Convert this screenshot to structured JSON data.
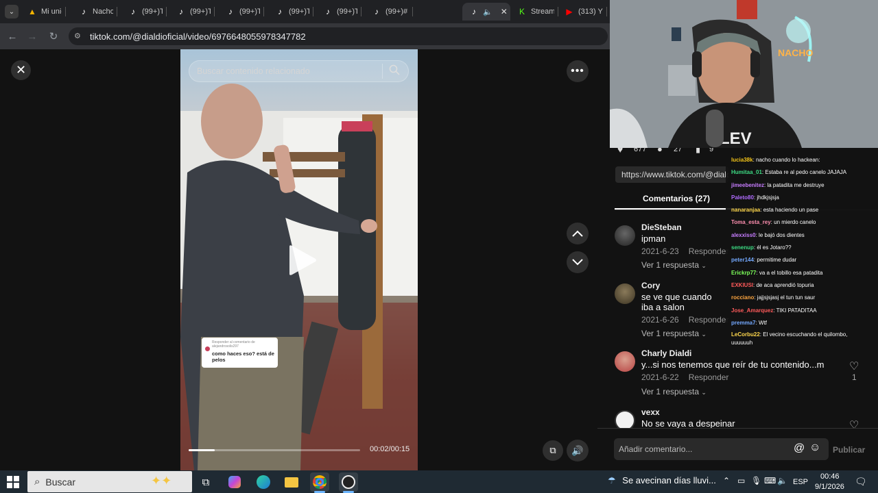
{
  "browser": {
    "tabs": [
      {
        "label": "Mi unio",
        "icon": "google-drive-icon"
      },
      {
        "label": "Nacho",
        "icon": "tiktok-icon"
      },
      {
        "label": "(99+)Ti",
        "icon": "tiktok-icon"
      },
      {
        "label": "(99+)Ti",
        "icon": "tiktok-icon"
      },
      {
        "label": "(99+)Ti",
        "icon": "tiktok-icon"
      },
      {
        "label": "(99+)Ti",
        "icon": "tiktok-icon"
      },
      {
        "label": "(99+)Ti",
        "icon": "tiktok-icon"
      },
      {
        "label": "(99+)#",
        "icon": "tiktok-icon"
      },
      {
        "label": "Stream",
        "icon": "kick-icon"
      },
      {
        "label": "(313) Y",
        "icon": "youtube-icon"
      }
    ],
    "url": "tiktok.com/@dialdioficial/video/6976648055978347782"
  },
  "video": {
    "search_placeholder": "Buscar contenido relacionado",
    "reply_card_title": "Responder al comentario de",
    "reply_card_user": "alejandrosolis297",
    "reply_card_text": "como haces eso? está de pelos",
    "time": "00:02/00:15",
    "progress": 0.15
  },
  "sidebar": {
    "stats": {
      "likes": "677",
      "comments": "27",
      "saves": "9"
    },
    "share_url": "https://www.tiktok.com/@dialdi",
    "comments_tab": "Comentarios (27)",
    "comments": [
      {
        "name": "DieSteban",
        "text": "ipman",
        "date": "2021-6-23",
        "reply": "Responder",
        "more": "Ver 1 respuesta"
      },
      {
        "name": "Cory",
        "text": "se ve que cuando iba a salon",
        "date": "2021-6-26",
        "reply": "Responder",
        "more": "Ver 1 respuesta"
      },
      {
        "name": "Charly Dialdi",
        "text": "y...si nos tenemos que reír de tu contenido...m",
        "date": "2021-6-22",
        "reply": "Responder",
        "more": "Ver 1 respuesta",
        "likes": "1"
      },
      {
        "name": "vexx",
        "text": "No se vaya a despeinar",
        "date": "",
        "reply": "",
        "more": ""
      }
    ],
    "comment_placeholder": "Añadir comentario...",
    "publish": "Publicar"
  },
  "stream_chat": [
    {
      "user": "lucia38k",
      "msg": "nacho cuando lo hackean:",
      "color": "#f5c518"
    },
    {
      "user": "Humitaa_01",
      "msg": "Estaba re al pedo canelo JAJAJA",
      "color": "#3ddc84"
    },
    {
      "user": "jimeebenitez",
      "msg": "la patadita me destruye",
      "color": "#c77dff"
    },
    {
      "user": "Paleto80",
      "msg": "jhdkjsjsja",
      "color": "#b06cff"
    },
    {
      "user": "nanaranjaa",
      "msg": "esta haciendo un pase",
      "color": "#ffd84d"
    },
    {
      "user": "Toma_esta_rey",
      "msg": "un mierdo canelo",
      "color": "#ff8fb0"
    },
    {
      "user": "alexxiss0",
      "msg": "le bajó dos dientes",
      "color": "#c77dff"
    },
    {
      "user": "senenup",
      "msg": "él es Jotaro??",
      "color": "#3ddc84"
    },
    {
      "user": "peter144",
      "msg": "permitime dudar",
      "color": "#74a9ff"
    },
    {
      "user": "Erickrp77",
      "msg": "va a el tobillo esa patadita",
      "color": "#7dff5a"
    },
    {
      "user": "EXKIUSI",
      "msg": "de aca aprendió topuria",
      "color": "#ff5a5a"
    },
    {
      "user": "rocciano",
      "msg": "jajjsjsjasj el tun tun saur",
      "color": "#ffa640"
    },
    {
      "user": "Jose_Amarquez",
      "msg": "TIKI PATADITAA",
      "color": "#ff5a5a"
    },
    {
      "user": "premma7",
      "msg": "Wtf",
      "color": "#74a9ff"
    },
    {
      "user": "LeCorbu22",
      "msg": "El vecino escuchando el quilombo, uuuuuuh",
      "color": "#ffd84d"
    }
  ],
  "taskbar": {
    "search": "Buscar",
    "weather": "Se avecinan días lluvi...",
    "lang": "ESP",
    "time": "00:46",
    "date": "9/1/2026"
  }
}
